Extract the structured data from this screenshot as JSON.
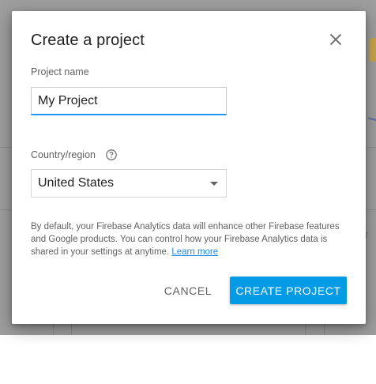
{
  "dialog": {
    "title": "Create a project",
    "close_icon": "close-icon"
  },
  "project_name": {
    "label": "Project name",
    "value": "My Project"
  },
  "country": {
    "label": "Country/region",
    "help_icon": "help-circle-icon",
    "selected": "United States",
    "dropdown_icon": "dropdown-arrow-icon"
  },
  "disclaimer": {
    "text": "By default, your Firebase Analytics data will enhance other Firebase features and Google products. You can control how your Firebase Analytics data is shared in your settings at anytime. ",
    "link": "Learn more"
  },
  "actions": {
    "cancel": "CANCEL",
    "create": "CREATE PROJECT"
  },
  "colors": {
    "primary": "#039be5",
    "focus_underline": "#2196f3",
    "link": "#1e88e5",
    "backdrop": "#9e9e9e"
  }
}
